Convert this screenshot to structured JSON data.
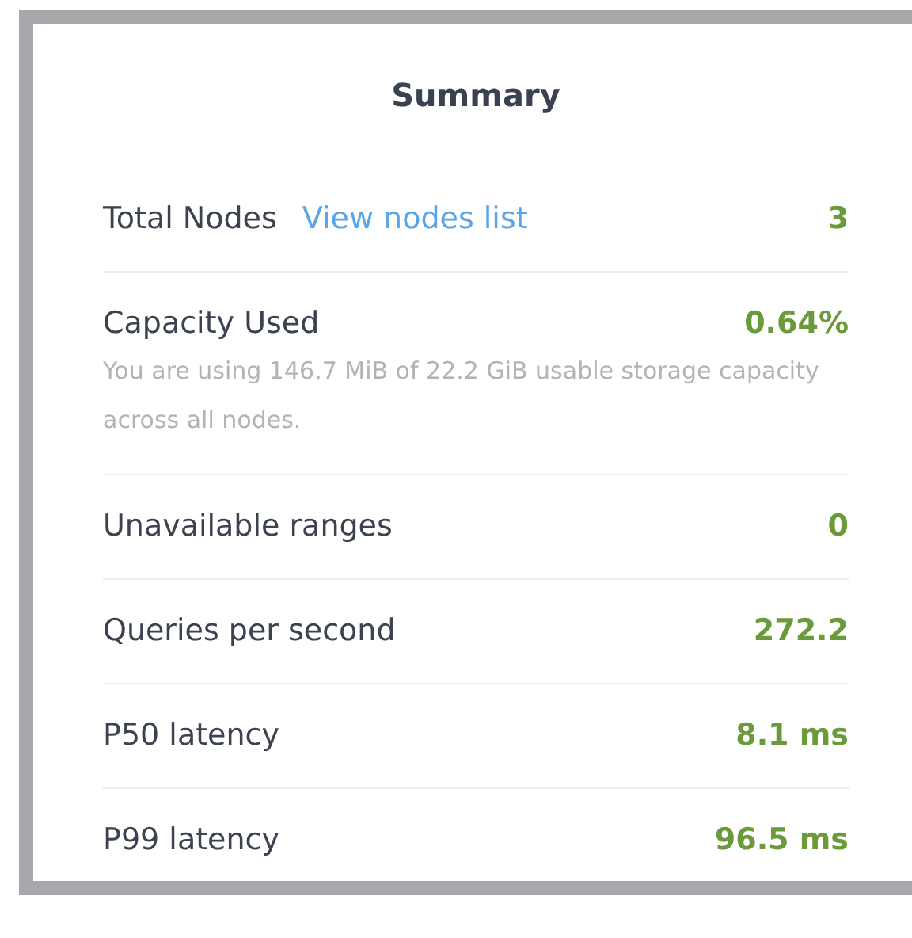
{
  "title": "Summary",
  "rows": [
    {
      "label": "Total Nodes",
      "link": "View nodes list",
      "value": "3"
    },
    {
      "label": "Capacity Used",
      "value": "0.64%",
      "description": "You are using 146.7 MiB of 22.2 GiB usable storage capacity across all nodes."
    },
    {
      "label": "Unavailable ranges",
      "value": "0"
    },
    {
      "label": "Queries per second",
      "value": "272.2"
    },
    {
      "label": "P50 latency",
      "value": "8.1 ms"
    },
    {
      "label": "P99 latency",
      "value": "96.5 ms"
    }
  ]
}
